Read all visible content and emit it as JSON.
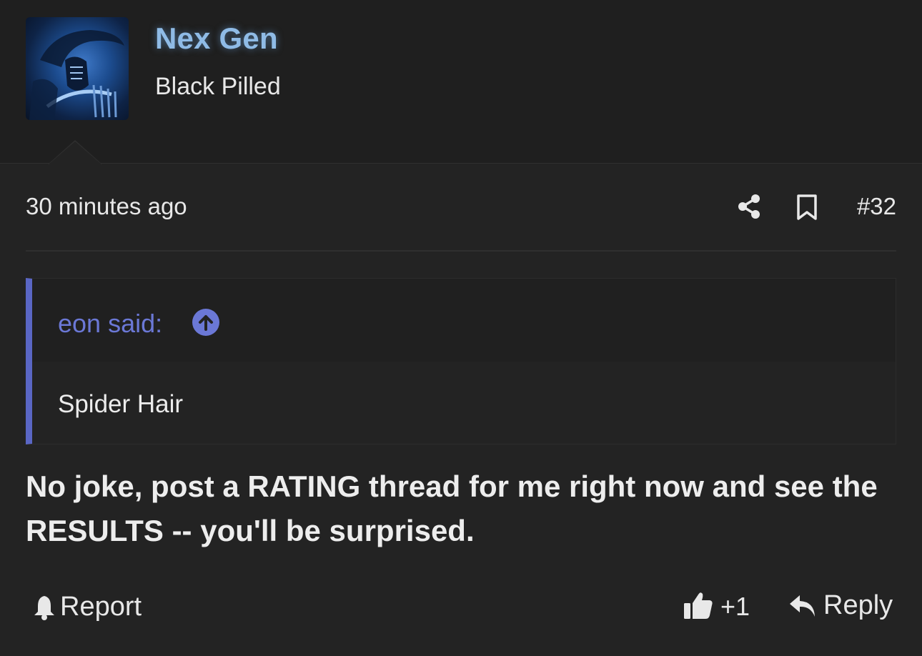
{
  "user": {
    "name": "Nex Gen",
    "title": "Black Pilled",
    "avatar": "alien-avatar"
  },
  "post": {
    "timestamp": "30 minutes ago",
    "number": "#32",
    "icons": {
      "share": "share-icon",
      "bookmark": "bookmark-icon"
    }
  },
  "quote": {
    "author_line": "eon said:",
    "jump_icon": "arrow-up-circle-icon",
    "body": "Spider Hair"
  },
  "message": {
    "text": "No joke, post a RATING thread for me right now and see the RESULTS -- you'll be surprised."
  },
  "footer": {
    "report_label": "Report",
    "reaction_count": "+1",
    "reply_label": "Reply",
    "icons": {
      "report": "bell-icon",
      "like": "thumbs-up-icon",
      "reply": "reply-icon"
    }
  },
  "colors": {
    "background": "#232323",
    "username": "#8fbbe6",
    "quote_accent": "#5a66c4",
    "quote_author": "#6b78d6"
  }
}
